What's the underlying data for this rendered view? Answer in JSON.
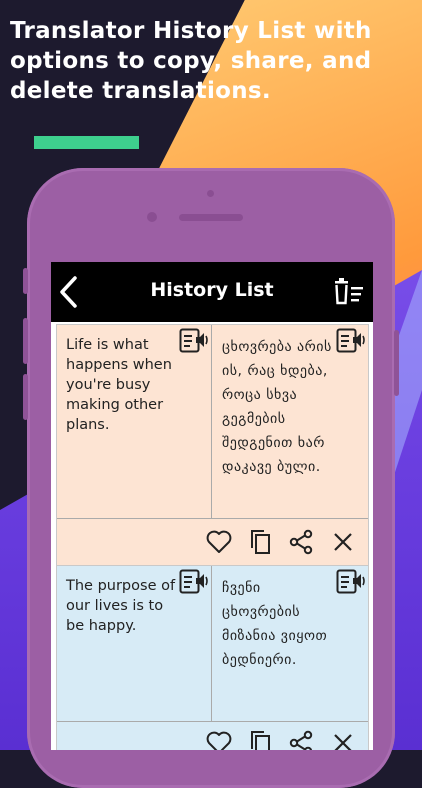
{
  "headline": "Translator History List with\noptions to copy, share, and\ndelete translations.",
  "colors": {
    "accent": "#3ecf8e",
    "phone": "#9c5fa4",
    "card1": "#fde4d3",
    "card2": "#d7ebf6"
  },
  "appbar": {
    "title": "History List",
    "back_icon": "chevron-left-icon",
    "clear_icon": "clear-history-icon"
  },
  "history": [
    {
      "source": "Life is what happens when you're busy making other plans.",
      "translation": "ცხოვრება არის ის, რაც ხდება, როცა სხვა გეგმების შედგენით ხარ დაკავე ბული.",
      "actions": [
        "heart-icon",
        "copy-icon",
        "share-icon",
        "close-icon"
      ]
    },
    {
      "source": "The purpose of our lives is to be happy.",
      "translation": "ჩვენი ცხოვრების მიზანია ვიყოთ ბედნიერი.",
      "actions": [
        "heart-icon",
        "copy-icon",
        "share-icon",
        "close-icon"
      ]
    }
  ]
}
